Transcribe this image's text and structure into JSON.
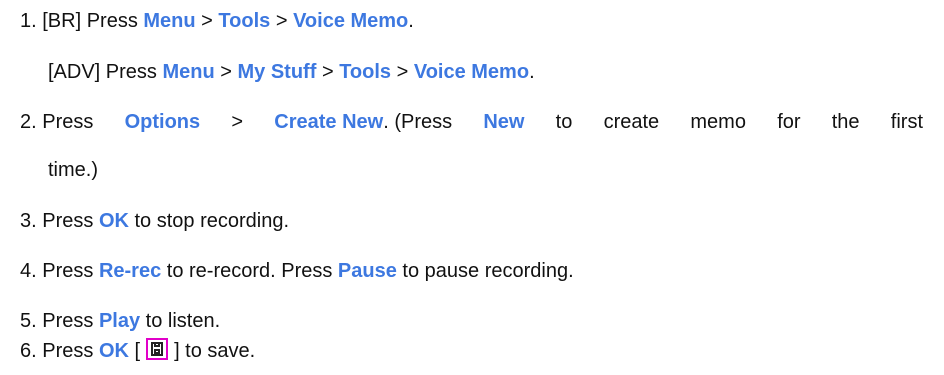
{
  "steps": {
    "s1": {
      "num": "1. ",
      "prefix": "[BR] Press ",
      "k1": "Menu",
      "sep1": " > ",
      "k2": "Tools",
      "sep2": " > ",
      "k3": "Voice Memo",
      "end": "."
    },
    "s1b": {
      "prefix": "[ADV] Press ",
      "k1": "Menu",
      "sep1": " > ",
      "k2": "My Stuff",
      "sep2": " > ",
      "k3": "Tools",
      "sep3": " > ",
      "k4": "Voice Memo",
      "end": "."
    },
    "s2": {
      "num": "2. ",
      "w1": "Press",
      "k1": "Options",
      "sep1": ">",
      "k2": "Create New",
      "w2": ". (Press",
      "k3": "New",
      "w3": "to",
      "w4": "create",
      "w5": "memo",
      "w6": "for",
      "w7": "the",
      "w8": "first",
      "cont": "time.)"
    },
    "s3": {
      "num": "3. ",
      "prefix": "Press ",
      "k1": "OK",
      "suffix": " to stop recording."
    },
    "s4": {
      "num": "4. ",
      "prefix": "Press ",
      "k1": "Re-rec",
      "mid": " to re-record. Press ",
      "k2": "Pause",
      "suffix": " to pause recording."
    },
    "s5": {
      "num": "5. ",
      "prefix": "Press ",
      "k1": "Play",
      "suffix": " to listen."
    },
    "s6": {
      "num": "6. ",
      "prefix": "Press ",
      "k1": "OK",
      "bracket_open": " [",
      "icon": "floppy-disk-icon",
      "suffix": "] to save."
    }
  },
  "colors": {
    "keyword": "#3d78e0",
    "icon_border": "#e100c8"
  }
}
